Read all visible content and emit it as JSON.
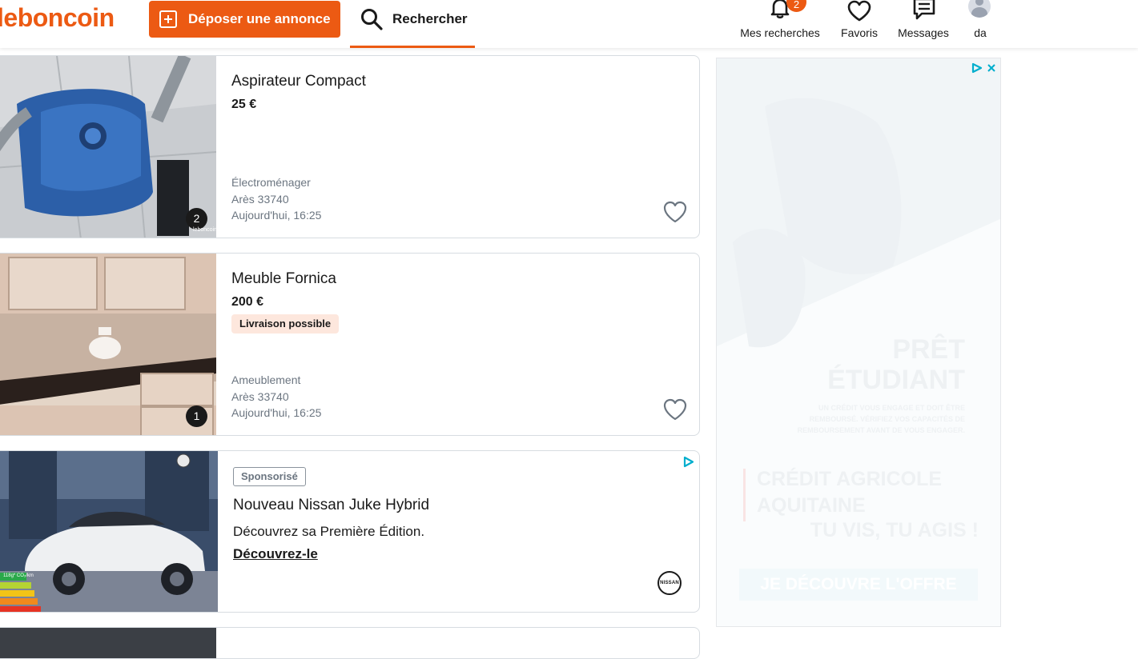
{
  "header": {
    "logo": "leboncoin",
    "post_button": "Déposer une annonce",
    "search_tab": "Rechercher",
    "nav": {
      "searches": "Mes recherches",
      "searches_badge": "2",
      "favorites": "Favoris",
      "messages": "Messages",
      "account": "da"
    }
  },
  "listings": [
    {
      "title": "Aspirateur Compact",
      "price": "25 €",
      "category": "Électroménager",
      "location": "Arès 33740",
      "date": "Aujourd'hui, 16:25",
      "photo_count": "2",
      "watermark": "leboncoin"
    },
    {
      "title": "Meuble Fornica",
      "price": "200 €",
      "tag": "Livraison possible",
      "category": "Ameublement",
      "location": "Arès 33740",
      "date": "Aujourd'hui, 16:25",
      "photo_count": "1"
    }
  ],
  "sponsored": {
    "label": "Sponsorisé",
    "title": "Nouveau Nissan Juke Hybrid",
    "description": "Découvrez sa Première Édition.",
    "link": "Découvrez-le",
    "brand": "NISSAN",
    "emission": "118g* CO₂/km"
  },
  "side_ad": {
    "headline_1": "PRÊT",
    "headline_2": "ÉTUDIANT",
    "disclaimer_1": "UN CRÉDIT VOUS ENGAGE ET DOIT ÊTRE",
    "disclaimer_2": "REMBOURSÉ. VÉRIFIEZ VOS CAPACITÉS DE",
    "disclaimer_3": "REMBOURSEMENT AVANT DE VOUS ENGAGER.",
    "brand_1": "CRÉDIT AGRICOLE",
    "brand_2": "AQUITAINE",
    "slogan": "TU VIS, TU AGIS !",
    "cta": "JE DÉCOUVRE L'OFFRE"
  },
  "colors": {
    "brand": "#ec5a13",
    "adchoices": "#00aecd"
  },
  "icons": [
    "plus-box-icon",
    "search-icon",
    "bell-icon",
    "heart-icon",
    "messages-icon",
    "avatar",
    "adchoices-icon",
    "close-icon"
  ]
}
